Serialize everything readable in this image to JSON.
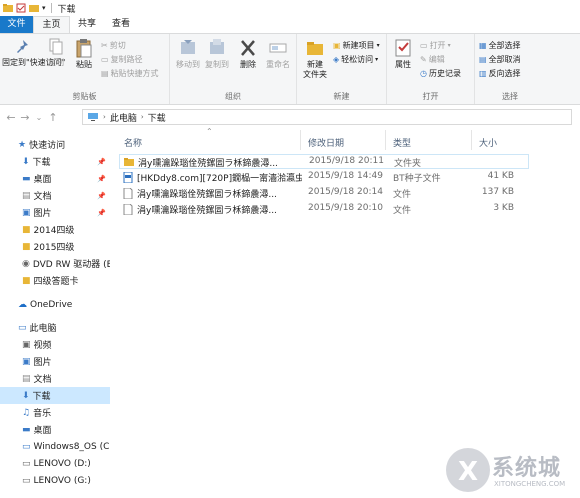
{
  "window": {
    "title": "下载"
  },
  "tabs": [
    "文件",
    "主页",
    "共享",
    "查看"
  ],
  "ribbon": {
    "clipboard": {
      "label": "剪贴板",
      "pin": "固定到\"快速访问\"",
      "copy": "复制",
      "paste": "粘贴",
      "cut": "剪切",
      "copy_path": "复制路径",
      "paste_shortcut": "粘贴快捷方式"
    },
    "organize": {
      "label": "组织",
      "move_to": "移动到",
      "copy_to": "复制到",
      "delete": "删除",
      "rename": "重命名"
    },
    "new": {
      "label": "新建",
      "new_folder": "新建\n文件夹",
      "new_item": "新建项目",
      "easy_access": "轻松访问"
    },
    "open": {
      "label": "打开",
      "properties": "属性",
      "open": "打开",
      "edit": "编辑",
      "history": "历史记录"
    },
    "select": {
      "label": "选择",
      "select_all": "全部选择",
      "select_none": "全部取消",
      "invert": "反向选择"
    }
  },
  "address": {
    "segments": [
      "此电脑",
      "下载"
    ]
  },
  "nav": {
    "quick_access": "快速访问",
    "items": [
      {
        "label": "下载",
        "pinned": true
      },
      {
        "label": "桌面",
        "pinned": true
      },
      {
        "label": "文档",
        "pinned": true
      },
      {
        "label": "图片",
        "pinned": true
      },
      {
        "label": "2014四级",
        "pinned": false
      },
      {
        "label": "2015四级",
        "pinned": false
      },
      {
        "label": "DVD RW 驱动器 (E:",
        "pinned": false
      },
      {
        "label": "四级答题卡",
        "pinned": false
      }
    ],
    "onedrive": "OneDrive",
    "this_pc": "此电脑",
    "pc_items": [
      "视频",
      "图片",
      "文档",
      "下载",
      "音乐",
      "桌面",
      "Windows8_OS (C:)",
      "LENOVO (D:)",
      "LENOVO (G:)"
    ]
  },
  "columns": {
    "name": "名称",
    "date": "修改日期",
    "type": "类型",
    "size": "大小"
  },
  "files": [
    {
      "name": "涓у嚑瀹跺瑙佺殑鏍囩ラ柇鍗曟潯...",
      "date": "2015/9/18 20:11",
      "type": "文件夹",
      "size": "",
      "icon": "folder-icon"
    },
    {
      "name": "[HKDdy8.com][720P]鐗榀一甯濇湁瀛虫...",
      "date": "2015/9/18 14:49",
      "type": "BT种子文件",
      "size": "41 KB",
      "icon": "torrent-file-icon"
    },
    {
      "name": "涓у嚑瀹跺瑙佺殑鏍囩ラ柇鍗曟潯...",
      "date": "2015/9/18 20:14",
      "type": "文件",
      "size": "137 KB",
      "icon": "file-icon"
    },
    {
      "name": "涓у嚑瀹跺瑙佺殑鏍囩ラ柇鍗曟潯...",
      "date": "2015/9/18 20:10",
      "type": "文件",
      "size": "3 KB",
      "icon": "file-icon"
    }
  ],
  "watermark": {
    "text": "系统城",
    "sub": "XITONGCHENG.COM"
  }
}
